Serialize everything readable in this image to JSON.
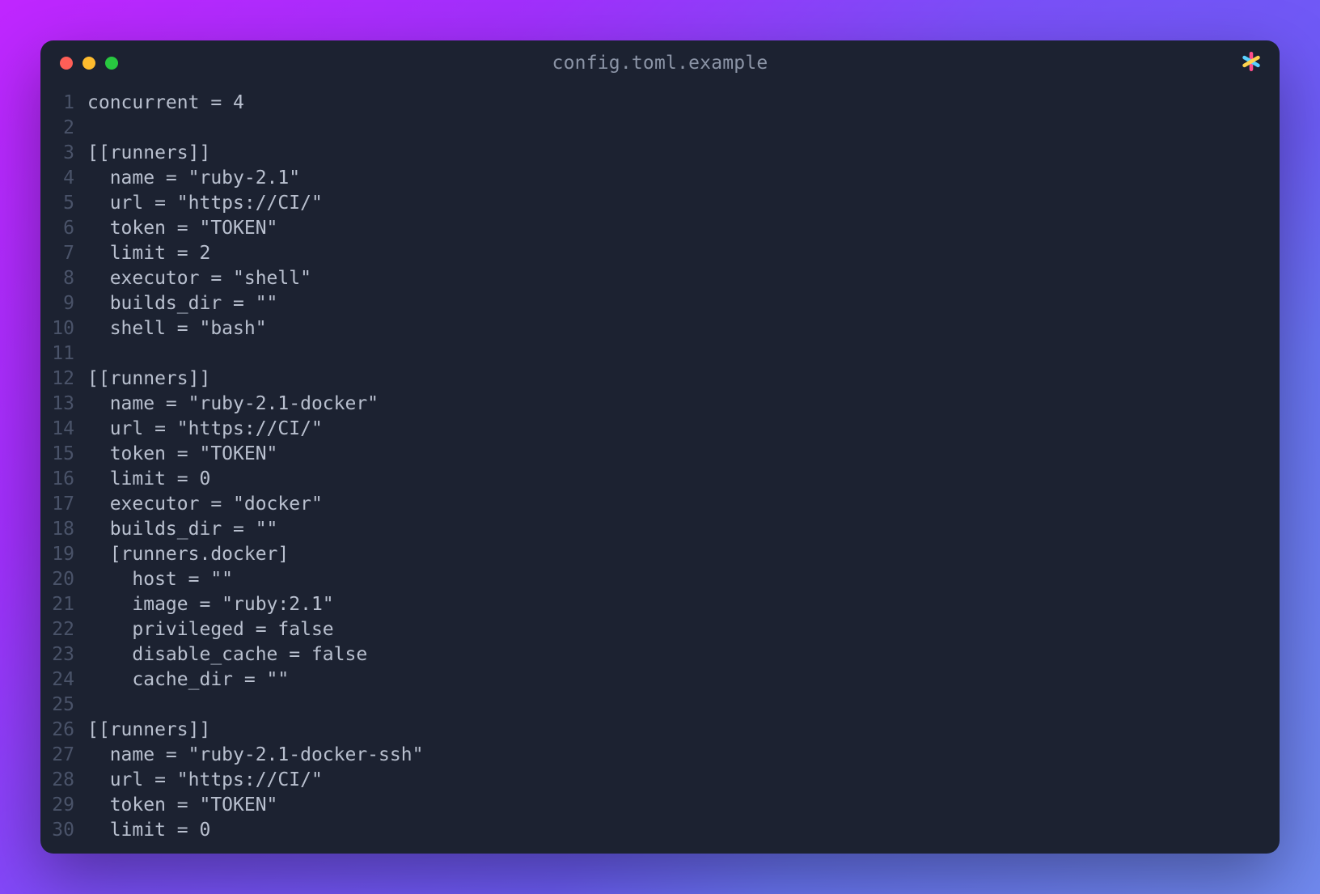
{
  "window": {
    "title": "config.toml.example"
  },
  "editor": {
    "lines": [
      {
        "num": "1",
        "text": "concurrent = 4"
      },
      {
        "num": "2",
        "text": ""
      },
      {
        "num": "3",
        "text": "[[runners]]"
      },
      {
        "num": "4",
        "text": "  name = \"ruby-2.1\""
      },
      {
        "num": "5",
        "text": "  url = \"https://CI/\""
      },
      {
        "num": "6",
        "text": "  token = \"TOKEN\""
      },
      {
        "num": "7",
        "text": "  limit = 2"
      },
      {
        "num": "8",
        "text": "  executor = \"shell\""
      },
      {
        "num": "9",
        "text": "  builds_dir = \"\""
      },
      {
        "num": "10",
        "text": "  shell = \"bash\""
      },
      {
        "num": "11",
        "text": ""
      },
      {
        "num": "12",
        "text": "[[runners]]"
      },
      {
        "num": "13",
        "text": "  name = \"ruby-2.1-docker\""
      },
      {
        "num": "14",
        "text": "  url = \"https://CI/\""
      },
      {
        "num": "15",
        "text": "  token = \"TOKEN\""
      },
      {
        "num": "16",
        "text": "  limit = 0"
      },
      {
        "num": "17",
        "text": "  executor = \"docker\""
      },
      {
        "num": "18",
        "text": "  builds_dir = \"\""
      },
      {
        "num": "19",
        "text": "  [runners.docker]"
      },
      {
        "num": "20",
        "text": "    host = \"\""
      },
      {
        "num": "21",
        "text": "    image = \"ruby:2.1\""
      },
      {
        "num": "22",
        "text": "    privileged = false"
      },
      {
        "num": "23",
        "text": "    disable_cache = false"
      },
      {
        "num": "24",
        "text": "    cache_dir = \"\""
      },
      {
        "num": "25",
        "text": ""
      },
      {
        "num": "26",
        "text": "[[runners]]"
      },
      {
        "num": "27",
        "text": "  name = \"ruby-2.1-docker-ssh\""
      },
      {
        "num": "28",
        "text": "  url = \"https://CI/\""
      },
      {
        "num": "29",
        "text": "  token = \"TOKEN\""
      },
      {
        "num": "30",
        "text": "  limit = 0"
      }
    ]
  }
}
